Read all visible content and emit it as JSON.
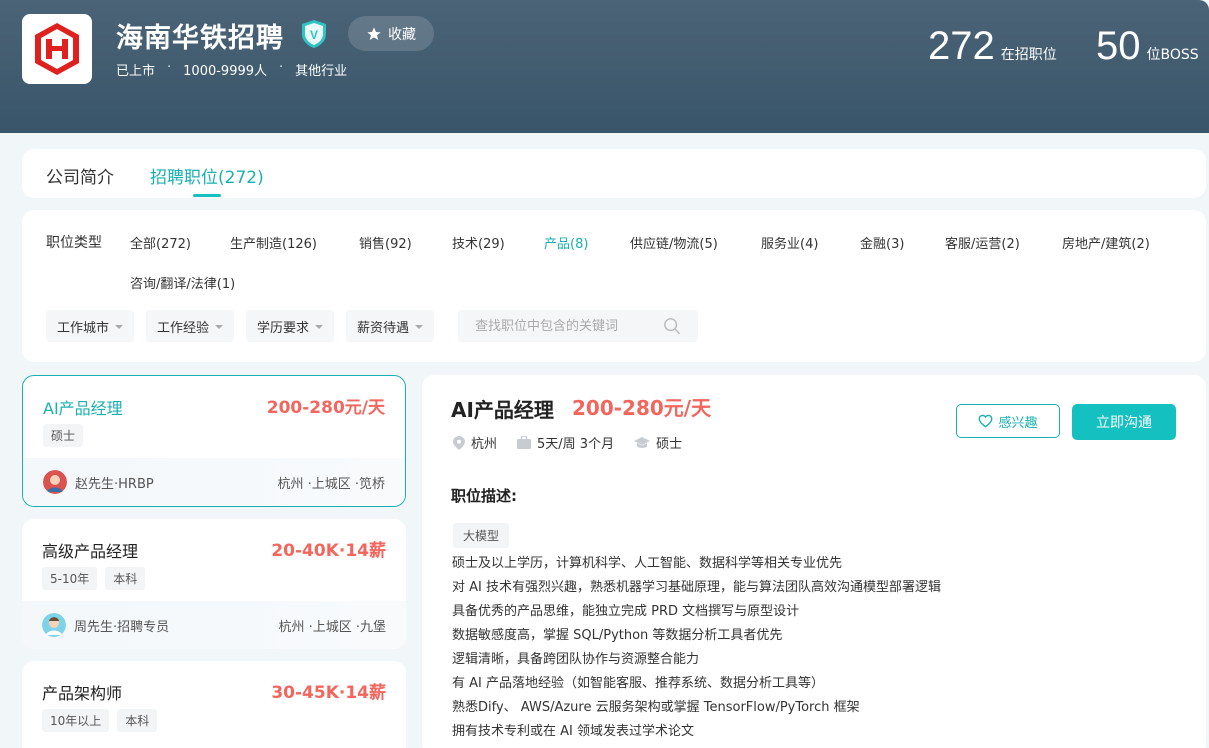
{
  "company": {
    "name": "海南华铁招聘",
    "status": "已上市",
    "size": "1000-9999人",
    "industry": "其他行业",
    "separator": "·",
    "favorite_label": "收藏",
    "stats": {
      "jobs_count": "272",
      "jobs_unit": "在招职位",
      "boss_count": "50",
      "boss_unit": "位BOSS"
    },
    "brand_color": "#e0201e"
  },
  "tabs": [
    {
      "label": "公司简介",
      "active": false
    },
    {
      "label": "招聘职位(272)",
      "active": true
    }
  ],
  "filters": {
    "category_label": "职位类型",
    "categories": [
      {
        "label": "全部(272)"
      },
      {
        "label": "生产制造(126)"
      },
      {
        "label": "销售(92)"
      },
      {
        "label": "技术(29)"
      },
      {
        "label": "产品(8)",
        "active": true
      },
      {
        "label": "供应链/物流(5)"
      },
      {
        "label": "服务业(4)"
      },
      {
        "label": "金融(3)"
      },
      {
        "label": "客服/运营(2)"
      },
      {
        "label": "房地产/建筑(2)"
      },
      {
        "label": "咨询/翻译/法律(1)"
      }
    ],
    "dropdowns": [
      {
        "label": "工作城市"
      },
      {
        "label": "工作经验"
      },
      {
        "label": "学历要求"
      },
      {
        "label": "薪资待遇"
      }
    ],
    "search_placeholder": "查找职位中包含的关键词"
  },
  "jobs": [
    {
      "title": "AI产品经理",
      "salary": "200-280元/天",
      "tags": [
        "硕士"
      ],
      "recruiter": "赵先生·HRBP",
      "location": "杭州 ·上城区 ·笕桥"
    },
    {
      "title": "高级产品经理",
      "salary": "20-40K·14薪",
      "tags": [
        "5-10年",
        "本科"
      ],
      "recruiter": "周先生·招聘专员",
      "location": "杭州 ·上城区 ·九堡"
    },
    {
      "title": "产品架构师",
      "salary": "30-45K·14薪",
      "tags": [
        "10年以上",
        "本科"
      ]
    }
  ],
  "detail": {
    "title": "AI产品经理",
    "salary": "200-280元/天",
    "city": "杭州",
    "schedule": "5天/周 3个月",
    "degree": "硕士",
    "interest_label": "感兴趣",
    "chat_label": "立即沟通",
    "desc_title": "职位描述:",
    "desc_tag": "大模型",
    "desc_lines": [
      "硕士及以上学历，计算机科学、人工智能、数据科学等相关专业优先",
      "对 AI 技术有强烈兴趣，熟悉机器学习基础原理，能与算法团队高效沟通模型部署逻辑",
      "具备优秀的产品思维，能独立完成 PRD 文档撰写与原型设计",
      "数据敏感度高，掌握 SQL/Python 等数据分析工具者优先",
      "逻辑清晰，具备跨团队协作与资源整合能力",
      "有 AI 产品落地经验（如智能客服、推荐系统、数据分析工具等）",
      "熟悉Dify、 AWS/Azure 云服务架构或掌握 TensorFlow/PyTorch 框架",
      "拥有技术专利或在 AI 领域发表过学术论文"
    ]
  },
  "colors": {
    "accent": "#1ab0b0",
    "salary": "#f2665d",
    "header": "#3f596d"
  }
}
